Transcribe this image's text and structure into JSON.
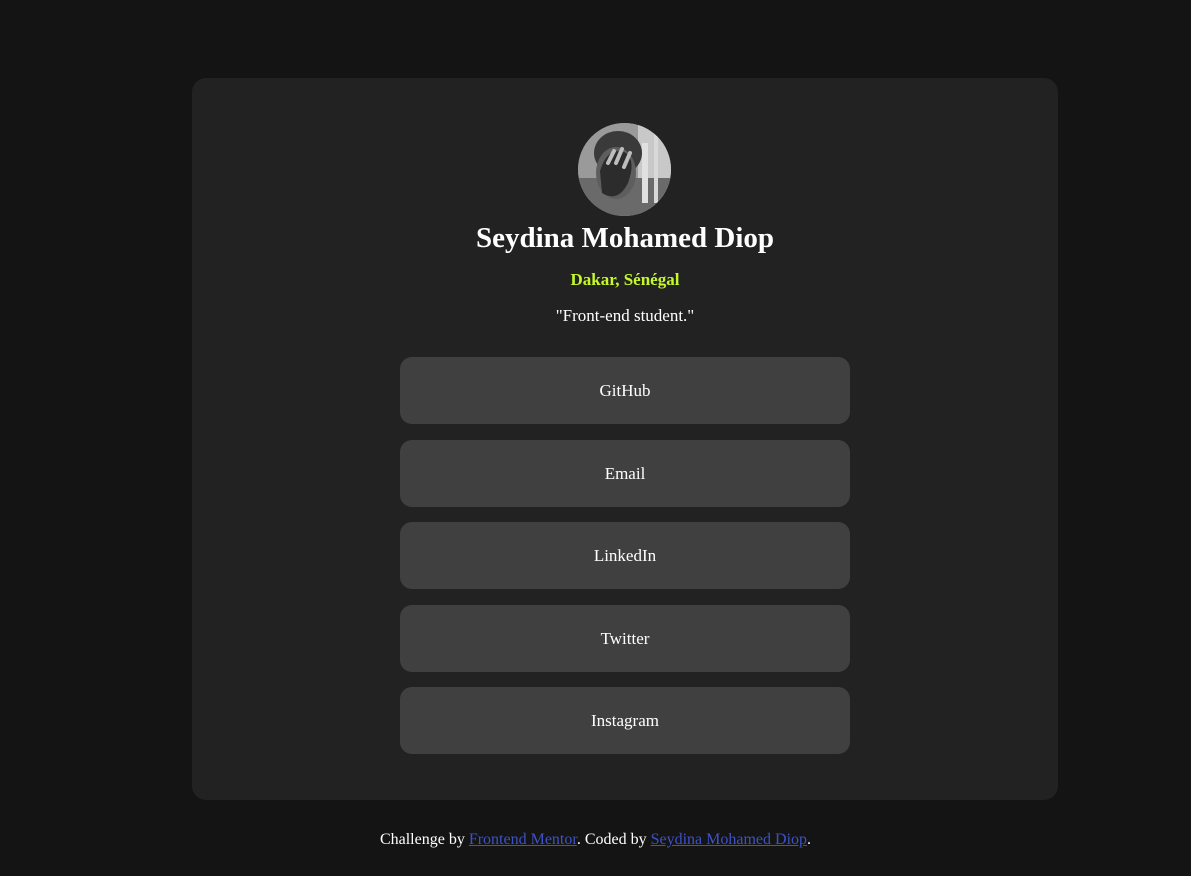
{
  "profile": {
    "avatar_icon": "profile-photo",
    "name": "Seydina Mohamed Diop",
    "location": "Dakar, Sénégal",
    "bio": "\"Front-end student.\""
  },
  "links": [
    {
      "label": "GitHub"
    },
    {
      "label": "Email"
    },
    {
      "label": "LinkedIn"
    },
    {
      "label": "Twitter"
    },
    {
      "label": "Instagram"
    }
  ],
  "footer": {
    "prefix": "Challenge by ",
    "challenge_link": "Frontend Mentor",
    "middle": ". Coded by ",
    "author_link": "Seydina Mohamed Diop",
    "suffix": "."
  },
  "colors": {
    "page_background": "#141414",
    "card_background": "#222222",
    "button_background": "#404040",
    "accent": "#c4f82a",
    "link": "#3e52c6"
  }
}
